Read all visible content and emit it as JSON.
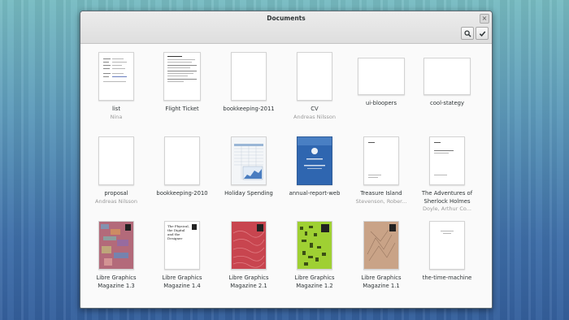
{
  "window": {
    "title": "Documents",
    "close_glyph": "×",
    "search_icon": "search-icon",
    "select_icon": "checkmark-icon"
  },
  "documents": [
    {
      "title": "list",
      "author": "Nina",
      "thumb": "text-doc"
    },
    {
      "title": "Flight Ticket",
      "author": "",
      "thumb": "text-doc"
    },
    {
      "title": "bookkeeping-2011",
      "author": "",
      "thumb": "blank"
    },
    {
      "title": "CV",
      "author": "Andreas Nilsson",
      "thumb": "blank"
    },
    {
      "title": "ui-bloopers",
      "author": "",
      "thumb": "blank-landscape"
    },
    {
      "title": "cool-stategy",
      "author": "",
      "thumb": "blank-landscape"
    },
    {
      "title": "proposal",
      "author": "Andreas Nilsson",
      "thumb": "blank"
    },
    {
      "title": "bookkeeping-2010",
      "author": "",
      "thumb": "blank"
    },
    {
      "title": "Holiday Spending",
      "author": "",
      "thumb": "spreadsheet"
    },
    {
      "title": "annual-report-web",
      "author": "",
      "thumb": "blue-cover"
    },
    {
      "title": "Treasure Island",
      "author": "Stevenson, Rober...",
      "thumb": "book"
    },
    {
      "title": "The Adventures of Sherlock Holmes",
      "line1": "The Adventures of",
      "line2": "Sherlock Holmes",
      "author": "Doyle, Arthur Co...",
      "thumb": "book"
    },
    {
      "title": "Libre Graphics Magazine 1.3",
      "line1": "Libre Graphics",
      "line2": "Magazine 1.3",
      "author": "",
      "thumb": "magazine",
      "color": "#b36a7a"
    },
    {
      "title": "Libre Graphics Magazine 1.4",
      "line1": "Libre Graphics",
      "line2": "Magazine 1.4",
      "author": "",
      "thumb": "magazine-text",
      "cover_text": "The Physical, the Digital and the Designer"
    },
    {
      "title": "Libre Graphics Magazine 2.1",
      "line1": "Libre Graphics",
      "line2": "Magazine 2.1",
      "author": "",
      "thumb": "magazine",
      "color": "#c8454f"
    },
    {
      "title": "Libre Graphics Magazine 1.2",
      "line1": "Libre Graphics",
      "line2": "Magazine 1.2",
      "author": "",
      "thumb": "magazine",
      "color": "#9fd033"
    },
    {
      "title": "Libre Graphics Magazine 1.1",
      "line1": "Libre Graphics",
      "line2": "Magazine 1.1",
      "author": "",
      "thumb": "magazine",
      "color": "#c9a387"
    },
    {
      "title": "the-time-machine",
      "author": "",
      "thumb": "faint"
    }
  ]
}
